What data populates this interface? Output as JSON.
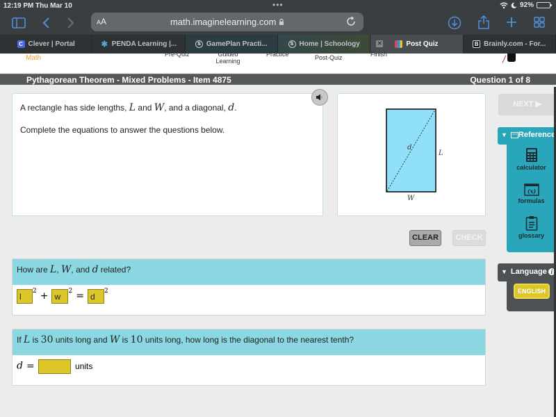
{
  "status_bar": {
    "time": "12:19 PM",
    "date": "Thu Mar 10",
    "battery_percent": "92%",
    "battery_level": 0.92
  },
  "browser": {
    "text_size_label": "AA",
    "url": "math.imaginelearning.com",
    "tabs": [
      {
        "label": "Clever | Portal",
        "icon": "clever-icon",
        "active": false
      },
      {
        "label": "PENDA Learning |...",
        "icon": "penda-icon",
        "active": false
      },
      {
        "label": "GamePlan Practi...",
        "icon": "schoology-icon",
        "active": false
      },
      {
        "label": "Home | Schoology",
        "icon": "schoology-icon",
        "active": false
      },
      {
        "label": "Post Quiz",
        "icon": "imagine-learning-icon",
        "active": true
      },
      {
        "label": "Brainly.com - For...",
        "icon": "brainly-icon",
        "active": false
      }
    ]
  },
  "lesson_nav": {
    "subject": "Math",
    "steps": [
      "Pre-Quiz",
      "Guided Learning",
      "Practice",
      "Post-Quiz",
      "Finish"
    ]
  },
  "header": {
    "title": "Pythagorean Theorem - Mixed Problems - Item 4875",
    "progress": "Question 1 of 8"
  },
  "prompt": {
    "line1_pre": "A rectangle has side lengths,",
    "var_L": "L",
    "and": "and",
    "var_W": "W",
    "line1_mid": ", and a diagonal,",
    "var_d": "d",
    "period": ".",
    "line2": "Complete the equations to answer the questions below."
  },
  "figure": {
    "label_diagonal": "d",
    "label_length": "L",
    "label_width": "W",
    "fill_color": "#8fe0f8"
  },
  "buttons": {
    "clear": "CLEAR",
    "check": "CHECK",
    "next": "NEXT ▶"
  },
  "questions": [
    {
      "prompt_pre": "How are",
      "var_L": "L",
      "comma1": ",",
      "var_W": "W",
      "mid": ", and",
      "var_d": "d",
      "post": "related?",
      "answers": [
        "l",
        "w",
        "d"
      ],
      "exponent": "2",
      "plus": "+",
      "equals": "="
    },
    {
      "prompt_if": "If",
      "var_L": "L",
      "is": "is",
      "L_value": "30",
      "mid": "units long and",
      "var_W": "W",
      "W_value": "10",
      "post": "units long, how long is the diagonal to the nearest tenth?",
      "lhs_var": "d",
      "equals": "=",
      "answer": "",
      "unit": "units"
    }
  ],
  "sidebar": {
    "reference_title": "Reference",
    "reference_items": [
      {
        "label": "calculator",
        "icon": "calculator-icon"
      },
      {
        "label": "formulas",
        "icon": "formulas-icon"
      },
      {
        "label": "glossary",
        "icon": "glossary-icon"
      }
    ],
    "language_title": "Language",
    "language_button": "ENGLISH"
  },
  "colors": {
    "accent_teal": "#2aa6bb",
    "question_header": "#8bd8e3",
    "answer_box": "#dcc62a",
    "title_bar": "#555859"
  }
}
